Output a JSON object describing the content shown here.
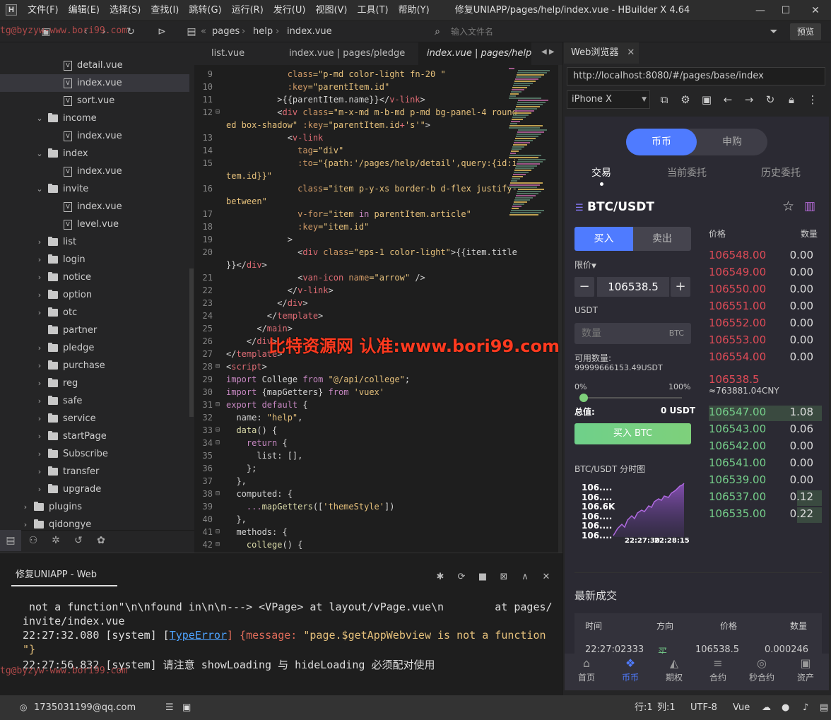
{
  "window": {
    "title": "修复UNIAPP/pages/help/index.vue - HBuilder X 4.64",
    "min": "—",
    "max": "☐",
    "close": "✕"
  },
  "menu": [
    "文件(F)",
    "编辑(E)",
    "选择(S)",
    "查找(I)",
    "跳转(G)",
    "运行(R)",
    "发行(U)",
    "视图(V)",
    "工具(T)",
    "帮助(Y)"
  ],
  "breadcrumb": [
    "pages",
    "help",
    "index.vue"
  ],
  "search": {
    "placeholder": "输入文件名"
  },
  "preview_label": "预览",
  "sidebar": {
    "items": [
      {
        "t": "file",
        "label": "detail.vue",
        "depth": 2
      },
      {
        "t": "file",
        "label": "index.vue",
        "depth": 2,
        "sel": true
      },
      {
        "t": "file",
        "label": "sort.vue",
        "depth": 2
      },
      {
        "t": "folder",
        "label": "income",
        "depth": 1,
        "open": true
      },
      {
        "t": "file",
        "label": "index.vue",
        "depth": 2
      },
      {
        "t": "folder",
        "label": "index",
        "depth": 1,
        "open": true
      },
      {
        "t": "file",
        "label": "index.vue",
        "depth": 2
      },
      {
        "t": "folder",
        "label": "invite",
        "depth": 1,
        "open": true
      },
      {
        "t": "file",
        "label": "index.vue",
        "depth": 2
      },
      {
        "t": "file",
        "label": "level.vue",
        "depth": 2
      },
      {
        "t": "folder",
        "label": "list",
        "depth": 1
      },
      {
        "t": "folder",
        "label": "login",
        "depth": 1
      },
      {
        "t": "folder",
        "label": "notice",
        "depth": 1
      },
      {
        "t": "folder",
        "label": "option",
        "depth": 1
      },
      {
        "t": "folder",
        "label": "otc",
        "depth": 1
      },
      {
        "t": "folder",
        "label": "partner",
        "depth": 1,
        "nochev": true
      },
      {
        "t": "folder",
        "label": "pledge",
        "depth": 1
      },
      {
        "t": "folder",
        "label": "purchase",
        "depth": 1
      },
      {
        "t": "folder",
        "label": "reg",
        "depth": 1
      },
      {
        "t": "folder",
        "label": "safe",
        "depth": 1
      },
      {
        "t": "folder",
        "label": "service",
        "depth": 1
      },
      {
        "t": "folder",
        "label": "startPage",
        "depth": 1
      },
      {
        "t": "folder",
        "label": "Subscribe",
        "depth": 1
      },
      {
        "t": "folder",
        "label": "transfer",
        "depth": 1
      },
      {
        "t": "folder",
        "label": "upgrade",
        "depth": 1
      },
      {
        "t": "folder",
        "label": "plugins",
        "depth": 0
      },
      {
        "t": "folder",
        "label": "qidongye",
        "depth": 0
      }
    ]
  },
  "editor": {
    "tabs": [
      "list.vue",
      "index.vue | pages/pledge",
      "index.vue | pages/help"
    ],
    "lines": [
      {
        "n": "9",
        "c": [
          [
            "            ",
            "pl"
          ],
          [
            "class",
            "at"
          ],
          [
            "=\"p-md color-light fn-20 \"",
            "st"
          ]
        ]
      },
      {
        "n": "10",
        "c": [
          [
            "            ",
            "pl"
          ],
          [
            ":key",
            "at"
          ],
          [
            "=\"parentItem.id\"",
            "st"
          ]
        ]
      },
      {
        "n": "11",
        "c": [
          [
            "          >{{parentItem.name}}</",
            "pl"
          ],
          [
            "v-link",
            "tg"
          ],
          [
            ">",
            "pl"
          ]
        ]
      },
      {
        "n": "12",
        "f": true,
        "c": [
          [
            "          <",
            "pl"
          ],
          [
            "div ",
            "tg"
          ],
          [
            "class",
            "at"
          ],
          [
            "=\"m-x-md m-b-md p-md bg-panel-4 round",
            "st"
          ]
        ]
      },
      {
        "n": "",
        "c": [
          [
            "ed box-shadow\" ",
            "st"
          ],
          [
            ":key",
            "at"
          ],
          [
            "=\"parentItem.id",
            "st"
          ],
          [
            "+",
            "tg"
          ],
          [
            "'s'\"",
            "st"
          ],
          [
            ">",
            "pl"
          ]
        ]
      },
      {
        "n": "13",
        "c": [
          [
            "            <",
            "pl"
          ],
          [
            "v-link",
            "tg"
          ]
        ]
      },
      {
        "n": "14",
        "c": [
          [
            "              ",
            "pl"
          ],
          [
            "tag",
            "at"
          ],
          [
            "=\"div\"",
            "st"
          ]
        ]
      },
      {
        "n": "15",
        "c": [
          [
            "              ",
            "pl"
          ],
          [
            ":to",
            "at"
          ],
          [
            "=\"{path:'/pages/help/detail',query:{id:i",
            "st"
          ]
        ]
      },
      {
        "n": "",
        "c": [
          [
            "tem.id}}\"",
            "st"
          ]
        ]
      },
      {
        "n": "16",
        "c": [
          [
            "              ",
            "pl"
          ],
          [
            "class",
            "at"
          ],
          [
            "=\"item p-y-xs border-b d-flex justify-",
            "st"
          ]
        ]
      },
      {
        "n": "",
        "c": [
          [
            "between\"",
            "st"
          ]
        ]
      },
      {
        "n": "17",
        "c": [
          [
            "              ",
            "pl"
          ],
          [
            "v-for",
            "at"
          ],
          [
            "=\"item ",
            "st"
          ],
          [
            "in",
            "kw"
          ],
          [
            " parentItem.article\"",
            "st"
          ]
        ]
      },
      {
        "n": "18",
        "c": [
          [
            "              ",
            "pl"
          ],
          [
            ":key",
            "at"
          ],
          [
            "=\"item.id\"",
            "st"
          ]
        ]
      },
      {
        "n": "19",
        "c": [
          [
            "            >",
            "pl"
          ]
        ]
      },
      {
        "n": "20",
        "c": [
          [
            "              <",
            "pl"
          ],
          [
            "div ",
            "tg"
          ],
          [
            "class",
            "at"
          ],
          [
            "=\"eps-1 color-light\"",
            "st"
          ],
          [
            ">{{item.title",
            "pl"
          ]
        ]
      },
      {
        "n": "",
        "c": [
          [
            "}}</",
            "pl"
          ],
          [
            "div",
            "tg"
          ],
          [
            ">",
            "pl"
          ]
        ]
      },
      {
        "n": "21",
        "c": [
          [
            "              <",
            "pl"
          ],
          [
            "van-icon ",
            "tg"
          ],
          [
            "name",
            "at"
          ],
          [
            "=\"arrow\"",
            "st"
          ],
          [
            " />",
            "pl"
          ]
        ]
      },
      {
        "n": "22",
        "c": [
          [
            "            </",
            "pl"
          ],
          [
            "v-link",
            "tg"
          ],
          [
            ">",
            "pl"
          ]
        ]
      },
      {
        "n": "23",
        "c": [
          [
            "          </",
            "pl"
          ],
          [
            "div",
            "tg"
          ],
          [
            ">",
            "pl"
          ]
        ]
      },
      {
        "n": "24",
        "c": [
          [
            "        </",
            "pl"
          ],
          [
            "template",
            "tg"
          ],
          [
            ">",
            "pl"
          ]
        ]
      },
      {
        "n": "25",
        "c": [
          [
            "      </",
            "pl"
          ],
          [
            "main",
            "tg"
          ],
          [
            ">",
            "pl"
          ]
        ]
      },
      {
        "n": "26",
        "c": [
          [
            "    </",
            "pl"
          ],
          [
            "div",
            "tg"
          ],
          [
            ">",
            "pl"
          ]
        ]
      },
      {
        "n": "27",
        "c": [
          [
            "</",
            "pl"
          ],
          [
            "template",
            "tg"
          ],
          [
            ">",
            "pl"
          ]
        ]
      },
      {
        "n": "28",
        "f": true,
        "c": [
          [
            "<",
            "pl"
          ],
          [
            "script",
            "tg"
          ],
          [
            ">",
            "pl"
          ]
        ]
      },
      {
        "n": "29",
        "c": [
          [
            "import",
            "kw"
          ],
          [
            " College ",
            "pl"
          ],
          [
            "from",
            "kw"
          ],
          [
            " \"@/api/college\"",
            "st"
          ],
          [
            ";",
            "pl"
          ]
        ]
      },
      {
        "n": "30",
        "c": [
          [
            "import",
            "kw"
          ],
          [
            " {mapGetters} ",
            "pl"
          ],
          [
            "from",
            "kw"
          ],
          [
            " 'vuex'",
            "st"
          ]
        ]
      },
      {
        "n": "31",
        "f": true,
        "c": [
          [
            "export default",
            "kw"
          ],
          [
            " {",
            "pl"
          ]
        ]
      },
      {
        "n": "32",
        "c": [
          [
            "  name: ",
            "pl"
          ],
          [
            "\"help\"",
            "st"
          ],
          [
            ",",
            "pl"
          ]
        ]
      },
      {
        "n": "33",
        "f": true,
        "c": [
          [
            "  ",
            "pl"
          ],
          [
            "data",
            "fn"
          ],
          [
            "() {",
            "pl"
          ]
        ]
      },
      {
        "n": "34",
        "f": true,
        "c": [
          [
            "    ",
            "pl"
          ],
          [
            "return",
            "kw"
          ],
          [
            " {",
            "pl"
          ]
        ]
      },
      {
        "n": "35",
        "c": [
          [
            "      list: [],",
            "pl"
          ]
        ]
      },
      {
        "n": "36",
        "c": [
          [
            "    };",
            "pl"
          ]
        ]
      },
      {
        "n": "37",
        "c": [
          [
            "  },",
            "pl"
          ]
        ]
      },
      {
        "n": "38",
        "f": true,
        "c": [
          [
            "  computed: {",
            "pl"
          ]
        ]
      },
      {
        "n": "39",
        "c": [
          [
            "    ...",
            "kw"
          ],
          [
            "mapGetters",
            "fn"
          ],
          [
            "([",
            "pl"
          ],
          [
            "'themeStyle'",
            "st"
          ],
          [
            "])",
            "pl"
          ]
        ]
      },
      {
        "n": "40",
        "c": [
          [
            "  },",
            "pl"
          ]
        ]
      },
      {
        "n": "41",
        "f": true,
        "c": [
          [
            "  methods: {",
            "pl"
          ]
        ]
      },
      {
        "n": "42",
        "f": true,
        "c": [
          [
            "    ",
            "pl"
          ],
          [
            "college",
            "fn"
          ],
          [
            "() {",
            "pl"
          ]
        ]
      }
    ]
  },
  "watermark": "比特资源网 认准:www.bori99.com",
  "watermark_small_1": "tg@byzyw-www.bori99.com",
  "watermark_small_2": "tg@byzyw-www.bori99.com",
  "console": {
    "title": "修复UNIAPP - Web",
    "lines": [
      " not a function\"\\n\\nfound in\\n\\n---> <VPage> at layout/vPage.vue\\n        at pages/",
      "invite/index.vue"
    ],
    "l3_time": "22:27:32.080 [system] [",
    "l3_link": "TypeError",
    "l3_mid": "] {message: ",
    "l3_msg": "\"page.$getAppWebview is not a function",
    "l3_end": "\"}",
    "l4": "22:27:56.832 [system] 请注意 showLoading 与 hideLoading 必须配对使用"
  },
  "status": {
    "user": "1735031199@qq.com",
    "row": "行:1",
    "col": "列:1",
    "enc": "UTF-8",
    "lang": "Vue"
  },
  "browser": {
    "tab": "Web浏览器",
    "url": "http://localhost:8080/#/pages/base/index",
    "device": "iPhone X"
  },
  "phone": {
    "seg": [
      "币币",
      "申购"
    ],
    "tabs": [
      "交易",
      "当前委托",
      "历史委托"
    ],
    "pair": "BTC/USDT",
    "buy": "买入",
    "sell": "卖出",
    "order_type": "限价",
    "price": "106538.5",
    "unit": "USDT",
    "qty_placeholder": "数量",
    "qty_unit": "BTC",
    "avail_label": "可用数量:",
    "avail_value": "99999666153.49USDT",
    "pct_min": "0%",
    "pct_max": "100%",
    "total_label": "总值:",
    "total_value": "0 USDT",
    "buy_btn": "买入 BTC",
    "chart_title": "BTC/USDT 分时图",
    "chart_y": [
      "106....",
      "106....",
      "106.6K",
      "106....",
      "106....",
      "106...."
    ],
    "chart_x": [
      "22:27:30",
      "22:28:15"
    ],
    "ob_head": [
      "价格",
      "数量"
    ],
    "asks": [
      [
        "106548.00",
        "0.00"
      ],
      [
        "106549.00",
        "0.00"
      ],
      [
        "106550.00",
        "0.00"
      ],
      [
        "106551.00",
        "0.00"
      ],
      [
        "106552.00",
        "0.00"
      ],
      [
        "106553.00",
        "0.00"
      ],
      [
        "106554.00",
        "0.00"
      ]
    ],
    "mid_price": "106538.5",
    "mid_cny": "≈763881.04CNY",
    "bids": [
      [
        "106547.00",
        "1.08"
      ],
      [
        "106543.00",
        "0.06"
      ],
      [
        "106542.00",
        "0.00"
      ],
      [
        "106541.00",
        "0.00"
      ],
      [
        "106539.00",
        "0.00"
      ],
      [
        "106537.00",
        "0.12"
      ],
      [
        "106535.00",
        "0.22"
      ]
    ],
    "trades_title": "最新成交",
    "trade_head": [
      "时间",
      "方向",
      "价格",
      "数量"
    ],
    "trade_row": [
      "22:27:02333",
      "买",
      "106538.5",
      "0.000246"
    ],
    "nav": [
      "首页",
      "币币",
      "期权",
      "合约",
      "秒合约",
      "资产"
    ]
  }
}
